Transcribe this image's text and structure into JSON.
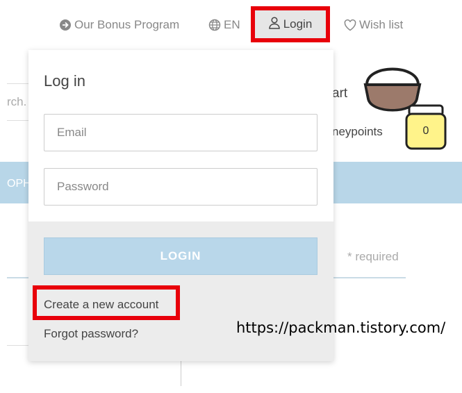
{
  "nav": {
    "bonus_label": "Our Bonus Program",
    "language_label": "EN",
    "login_label": "Login",
    "wishlist_label": "Wish list"
  },
  "background": {
    "search_fragment": "rch.",
    "cart_label_fragment": "art",
    "points_label_fragment": "neypoints",
    "points_value": "0",
    "banner_fragment": "OPH",
    "required_note": "* required"
  },
  "login_dropdown": {
    "title": "Log in",
    "email_placeholder": "Email",
    "password_placeholder": "Password",
    "login_button": "LOGIN",
    "create_account": "Create a new account",
    "forgot_password": "Forgot password?"
  },
  "overlay": {
    "watermark": "https://packman.tistory.com/"
  },
  "colors": {
    "highlight_red": "#e8000a",
    "accent_blue": "#b9d7ea",
    "jar_yellow": "#fff38a",
    "pot_brown": "#9c7a6b"
  },
  "icons": [
    "arrow-right-circle-icon",
    "globe-icon",
    "user-icon",
    "heart-icon",
    "honey-pot-icon",
    "honey-jar-icon"
  ]
}
